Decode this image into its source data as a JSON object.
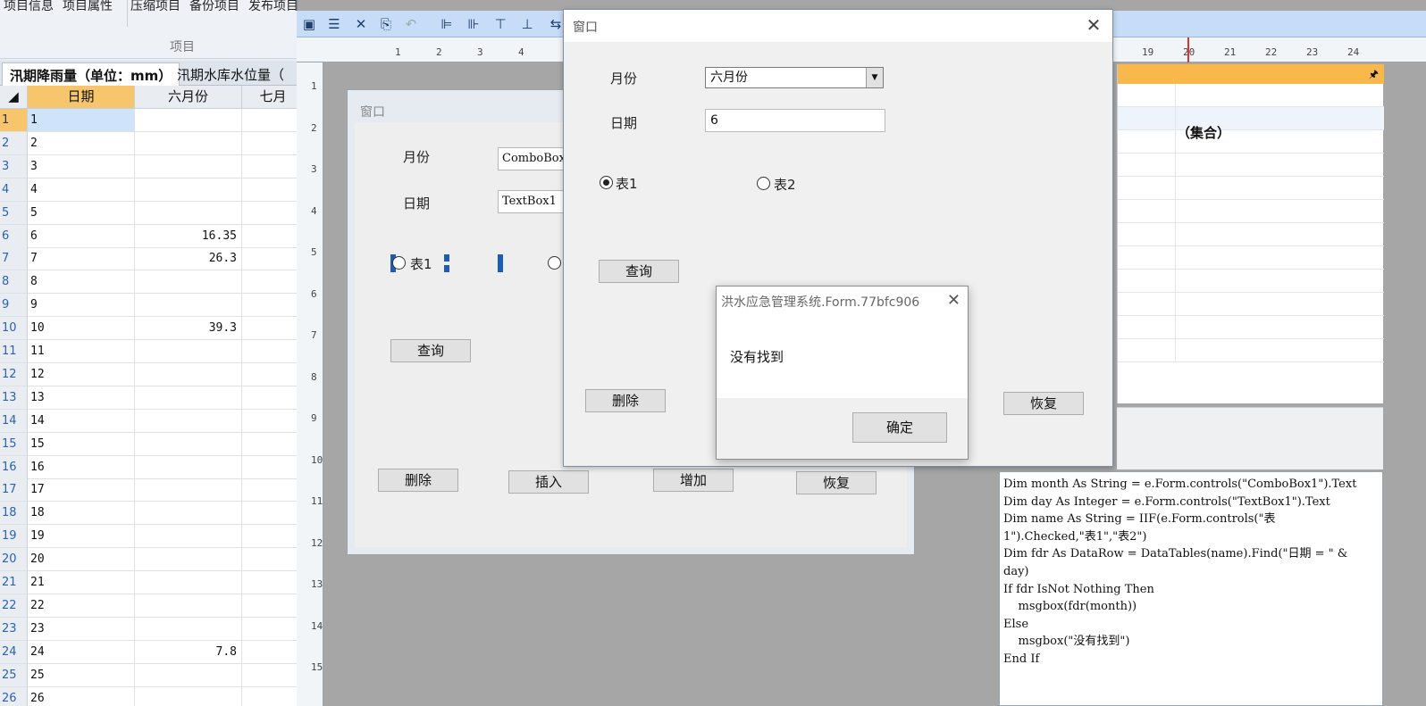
{
  "ribbon": {
    "buttons": [
      "项目信息",
      "项目属性",
      "压缩项目",
      "备份项目",
      "发布项目"
    ],
    "group_label": "项目"
  },
  "sheet_tabs": [
    {
      "label": "汛期降雨量（单位：mm）",
      "active": true
    },
    {
      "label": "汛期水库水位量（",
      "active": false
    }
  ],
  "grid": {
    "columns": [
      "日期",
      "六月份",
      "七月"
    ],
    "rows": [
      {
        "n": "1",
        "date": "1",
        "june": ""
      },
      {
        "n": "2",
        "date": "2",
        "june": ""
      },
      {
        "n": "3",
        "date": "3",
        "june": ""
      },
      {
        "n": "4",
        "date": "4",
        "june": ""
      },
      {
        "n": "5",
        "date": "5",
        "june": ""
      },
      {
        "n": "6",
        "date": "6",
        "june": "16.35"
      },
      {
        "n": "7",
        "date": "7",
        "june": "26.3"
      },
      {
        "n": "8",
        "date": "8",
        "june": ""
      },
      {
        "n": "9",
        "date": "9",
        "june": ""
      },
      {
        "n": "10",
        "date": "10",
        "june": "39.3"
      },
      {
        "n": "11",
        "date": "11",
        "june": ""
      },
      {
        "n": "12",
        "date": "12",
        "june": ""
      },
      {
        "n": "13",
        "date": "13",
        "june": ""
      },
      {
        "n": "14",
        "date": "14",
        "june": ""
      },
      {
        "n": "15",
        "date": "15",
        "june": ""
      },
      {
        "n": "16",
        "date": "16",
        "june": ""
      },
      {
        "n": "17",
        "date": "17",
        "june": ""
      },
      {
        "n": "18",
        "date": "18",
        "june": ""
      },
      {
        "n": "19",
        "date": "19",
        "june": ""
      },
      {
        "n": "20",
        "date": "20",
        "june": ""
      },
      {
        "n": "21",
        "date": "21",
        "june": ""
      },
      {
        "n": "22",
        "date": "22",
        "june": ""
      },
      {
        "n": "23",
        "date": "23",
        "june": ""
      },
      {
        "n": "24",
        "date": "24",
        "june": "7.8"
      },
      {
        "n": "25",
        "date": "25",
        "june": ""
      },
      {
        "n": "26",
        "date": "26",
        "june": ""
      }
    ]
  },
  "ruler": {
    "h_numbers": [
      "1",
      "2",
      "3",
      "4",
      "19",
      "20",
      "21",
      "22",
      "23",
      "24"
    ],
    "v_numbers": [
      "1",
      "2",
      "3",
      "4",
      "5",
      "6",
      "7",
      "8",
      "9",
      "10",
      "11",
      "12",
      "13",
      "14",
      "15"
    ]
  },
  "design_form": {
    "title": "窗口",
    "month_label": "月份",
    "date_label": "日期",
    "combo_text": "ComboBox1",
    "text_text": "TextBox1",
    "radio1_label": "表1",
    "query_btn": "查询",
    "delete_btn": "删除",
    "insert_btn": "插入",
    "add_btn": "增加",
    "restore_btn": "恢复"
  },
  "right_panel": {
    "cell_text": "（集合）"
  },
  "code": "Dim month As String = e.Form.controls(\"ComboBox1\").Text\nDim day As Integer = e.Form.controls(\"TextBox1\").Text\nDim name As String = IIF(e.Form.controls(\"表\n1\").Checked,\"表1\",\"表2\")\nDim fdr As DataRow = DataTables(name).Find(\"日期 = \" &\nday)\nIf fdr IsNot Nothing Then\n    msgbox(fdr(month))\nElse\n    msgbox(\"没有找到\")\nEnd If",
  "runtime_window": {
    "title": "窗口",
    "month_label": "月份",
    "month_value": "六月份",
    "date_label": "日期",
    "date_value": "6",
    "radio1_label": "表1",
    "radio2_label": "表2",
    "query_btn": "查询",
    "delete_btn": "删除",
    "restore_btn": "恢复"
  },
  "msgbox": {
    "title": "洪水应急管理系统.Form.77bfc906",
    "message": "没有找到",
    "ok_btn": "确定"
  }
}
